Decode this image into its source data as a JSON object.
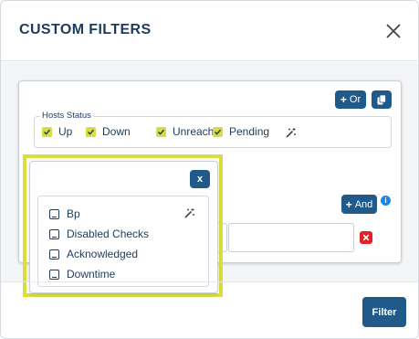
{
  "modal": {
    "title": "CUSTOM FILTERS",
    "close_icon": "close-icon"
  },
  "filter_card": {
    "or_button_label": "Or",
    "copy_icon": "copy-icon",
    "and_button_label": "And",
    "info_icon": "info-icon",
    "remove_icon": "remove-icon",
    "hosts_status": {
      "legend": "Hosts Status",
      "options": [
        {
          "label": "Up",
          "checked": true
        },
        {
          "label": "Down",
          "checked": true
        },
        {
          "label": "Unreach",
          "checked": true
        },
        {
          "label": "Pending",
          "checked": true
        }
      ],
      "wand_icon": "magic-wand-icon"
    }
  },
  "dropdown": {
    "close_label": "x",
    "items": [
      {
        "label": "Bp"
      },
      {
        "label": "Disabled Checks"
      },
      {
        "label": "Acknowledged"
      },
      {
        "label": "Downtime"
      }
    ],
    "wand_icon": "magic-wand-icon"
  },
  "footer": {
    "filter_button_label": "Filter"
  },
  "colors": {
    "primary": "#1f5a8a",
    "checkbox": "#d7dc45",
    "highlight": "#d9de3d",
    "danger": "#e0202a",
    "info": "#1e88e5"
  }
}
